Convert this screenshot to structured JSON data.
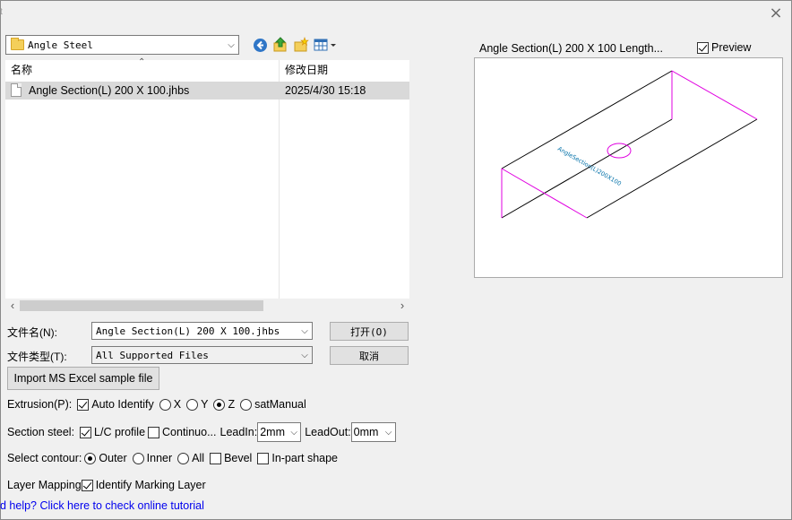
{
  "window": {
    "title_fragment": "t",
    "close_glyph": "×"
  },
  "toolbar": {
    "folder_path": "Angle Steel",
    "icons": [
      "back-icon",
      "up-folder-icon",
      "new-folder-icon",
      "view-menu-icon"
    ]
  },
  "file_list": {
    "columns": [
      "名称",
      "修改日期"
    ],
    "rows": [
      {
        "name": "Angle Section(L) 200 X 100.jhbs",
        "modified": "2025/4/30 15:18"
      }
    ]
  },
  "fields": {
    "filename_label": "文件名(N):",
    "filename_value": "Angle Section(L) 200 X 100.jhbs",
    "filetype_label": "文件类型(T):",
    "filetype_value": "All Supported Files",
    "open_label": "打开(O)",
    "cancel_label": "取消",
    "import_label": "Import MS Excel sample file"
  },
  "preview": {
    "title": "Angle Section(L) 200 X 100 Length...",
    "checkbox_label": "Preview",
    "checked": true,
    "drawing_text": "AngleSection(L)200X100"
  },
  "options": {
    "extrusion_label": "Extrusion(P):",
    "auto_identify": "Auto Identify",
    "axis_x": "X",
    "axis_y": "Y",
    "axis_z": "Z",
    "sat_manual": "satManual",
    "section_label": "Section steel:",
    "lc_profile": "L/C profile",
    "continuous": "Continuo...",
    "leadin_label": "LeadIn:",
    "leadin_value": "2mm",
    "leadout_label": "LeadOut:",
    "leadout_value": "0mm",
    "contour_label": "Select contour:",
    "outer": "Outer",
    "inner": "Inner",
    "all": "All",
    "bevel": "Bevel",
    "inpart": "In-part shape",
    "layer_label": "Layer Mapping",
    "identify_marking": "Identify Marking Layer"
  },
  "help": {
    "link_text": "d help? Click here to check online tutorial"
  },
  "colors": {
    "magenta": "#e000e0",
    "drawing_text": "#0070a8",
    "link": "#0000ee",
    "selection": "#d9d9d9"
  }
}
